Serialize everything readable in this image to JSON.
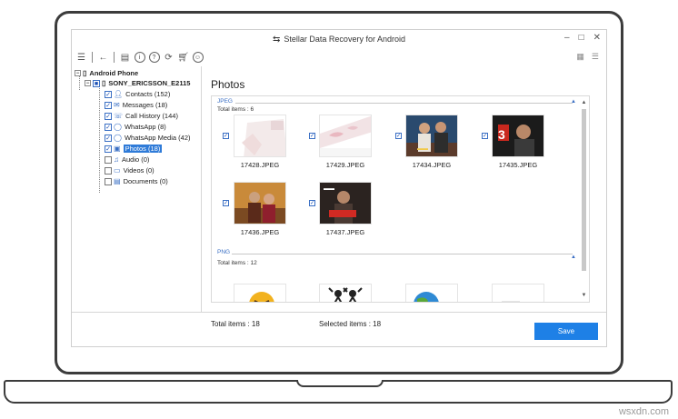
{
  "window": {
    "title": "Stellar Data Recovery for Android",
    "controls": [
      "–",
      "□",
      "✕"
    ]
  },
  "toolbar": {
    "icons": [
      "menu-icon",
      "back-icon",
      "save-icon",
      "info-icon",
      "help-icon",
      "refresh-icon",
      "cart-icon",
      "account-icon"
    ]
  },
  "tree": {
    "root": "Android Phone",
    "device": "SONY_ERICSSON_E2115",
    "items": [
      {
        "label": "Contacts (152)",
        "checked": true
      },
      {
        "label": "Messages (18)",
        "checked": true
      },
      {
        "label": "Call History (144)",
        "checked": true
      },
      {
        "label": "WhatsApp (8)",
        "checked": true
      },
      {
        "label": "WhatsApp Media (42)",
        "checked": true
      },
      {
        "label": "Photos (18)",
        "checked": true,
        "selected": true
      },
      {
        "label": "Audio (0)",
        "checked": false
      },
      {
        "label": "Videos (0)",
        "checked": false
      },
      {
        "label": "Documents (0)",
        "checked": false
      }
    ]
  },
  "content": {
    "title": "Photos",
    "groups": [
      {
        "name": "JPEG",
        "total": "Total items : 6",
        "thumbs": [
          "17428.JPEG",
          "17429.JPEG",
          "17434.JPEG",
          "17435.JPEG",
          "17436.JPEG",
          "17437.JPEG"
        ]
      },
      {
        "name": "PNG",
        "total": "Total items : 12"
      }
    ]
  },
  "status": {
    "total_items": "Total items : 18",
    "selected_items": "Selected items : 18",
    "save_label": "Save"
  },
  "colors": {
    "accent": "#1e80e6",
    "selection": "#2f7bd8",
    "group_label": "#3a6fc4"
  },
  "watermark": "wsxdn.com"
}
